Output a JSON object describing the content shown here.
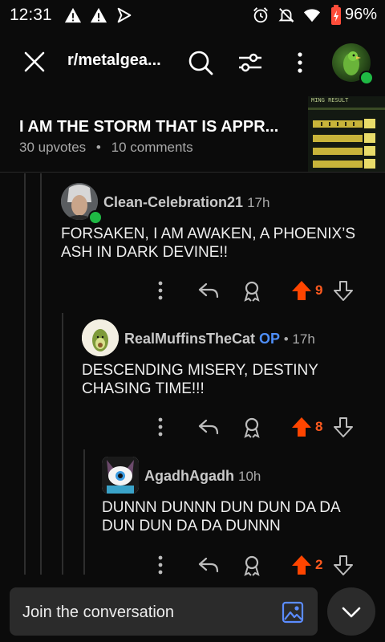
{
  "status_bar": {
    "time": "12:31",
    "battery": "96%",
    "icons": [
      "warning-icon",
      "warning-icon",
      "vpn-icon",
      "alarm-icon",
      "mute-icon",
      "wifi-icon",
      "battery-charging-icon"
    ]
  },
  "header": {
    "subreddit": "r/metalgea...",
    "icons": [
      "close-icon",
      "search-icon",
      "filter-icon",
      "more-vertical-icon",
      "user-avatar"
    ]
  },
  "post": {
    "title": "I AM THE STORM THAT IS APPR...",
    "upvotes": "30 upvotes",
    "separator": "•",
    "comments": "10 comments",
    "thumbnail_text": "MING RESULT"
  },
  "comments": [
    {
      "user": "Clean-Celebration21",
      "op": "",
      "time": "17h",
      "body": "FORSAKEN, I AM AWAKEN, A PHOENIX’S ASH IN DARK DEVINE!!",
      "votes": "9"
    },
    {
      "user": "RealMuffinsTheCat",
      "op": "OP",
      "time": "• 17h",
      "body": "DESCENDING MISERY, DESTINY CHASING TIME!!!",
      "votes": "8"
    },
    {
      "user": "AgadhAgadh",
      "op": "",
      "time": "10h",
      "body": "DUNNN DUNNN DUN DUN DA DA DUN DUN DA DA DUNNN",
      "votes": "2"
    }
  ],
  "bottom_bar": {
    "placeholder": "Join the conversation"
  },
  "colors": {
    "background": "#0b0b0b",
    "upvote_active": "#ff4500",
    "op_badge": "#4e8ef7",
    "online": "#1fb944"
  }
}
